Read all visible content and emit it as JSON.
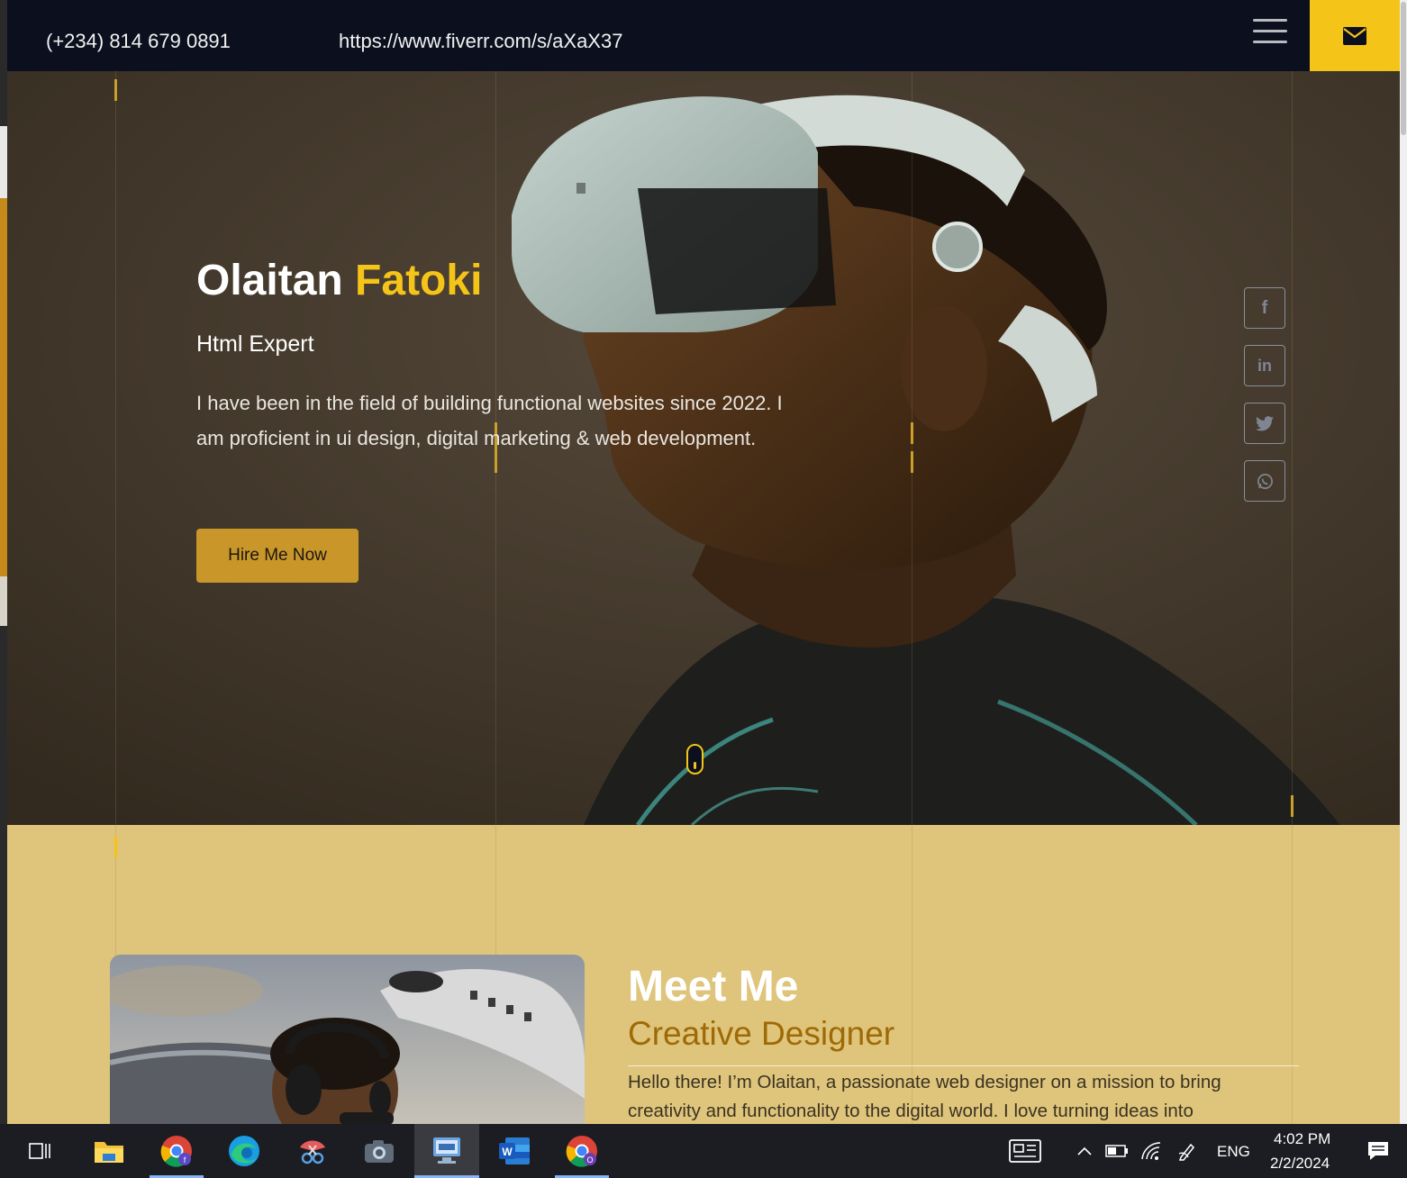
{
  "topbar": {
    "phone": "(+234) 814 679 0891",
    "fiverr_link": "https://www.fiverr.com/s/aXaX37",
    "menu_icon": "hamburger-menu-icon",
    "mail_icon": "envelope-icon"
  },
  "hero": {
    "first_name": "Olaitan",
    "last_name": "Fatoki",
    "subtitle": "Html Expert",
    "description": "I have been in the field of building functional websites since 2022. I am proficient in ui design, digital marketing & web development.",
    "cta_label": "Hire Me Now",
    "social": [
      {
        "name": "facebook",
        "glyph": "f"
      },
      {
        "name": "linkedin",
        "glyph": "in"
      },
      {
        "name": "twitter",
        "glyph": "twitter"
      },
      {
        "name": "whatsapp",
        "glyph": "whatsapp"
      }
    ],
    "scroll_icon": "mouse-scroll-icon"
  },
  "about": {
    "title": "Meet Me",
    "subtitle": "Creative Designer",
    "description": "Hello there! I’m Olaitan, a passionate web designer on a mission to bring creativity and functionality to the digital world. I love turning ideas into"
  },
  "taskbar": {
    "apps": [
      "task-view",
      "file-explorer",
      "chrome",
      "edge",
      "snipping-tool",
      "camera",
      "remote-desktop",
      "word",
      "chrome-profile"
    ],
    "language": "ENG",
    "time": "4:02 PM",
    "date": "2/2/2024"
  },
  "colors": {
    "accent": "#f5c419",
    "topbar_bg": "#0b0f1e",
    "about_bg": "#dfc47c",
    "button": "#c9962a"
  }
}
